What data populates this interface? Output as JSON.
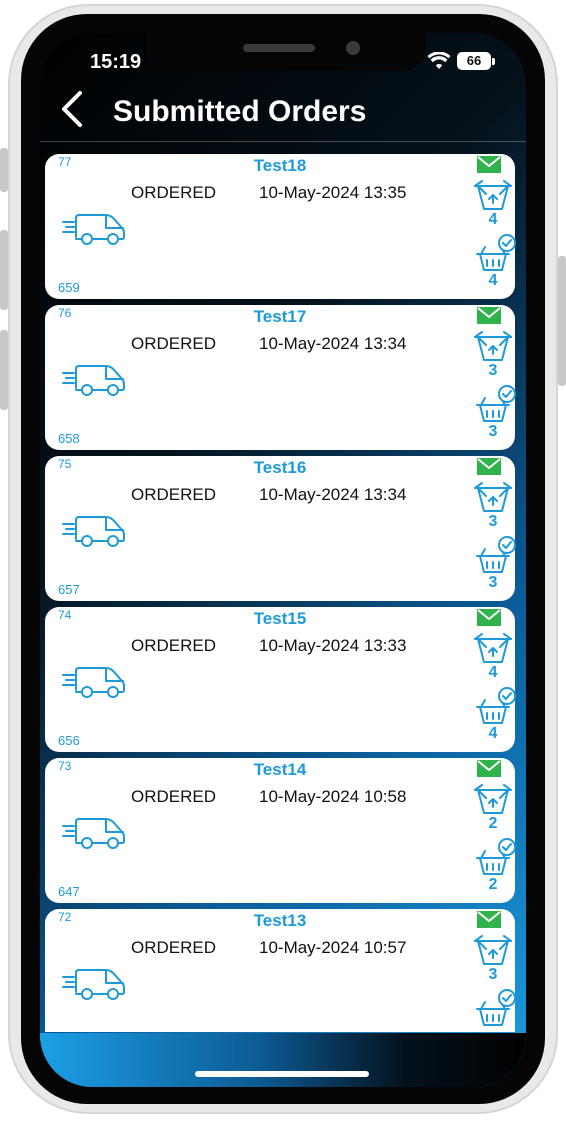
{
  "status_bar": {
    "time": "15:19",
    "battery": "66"
  },
  "header": {
    "title": "Submitted Orders"
  },
  "orders": [
    {
      "id": "77",
      "name": "Test18",
      "status": "ORDERED",
      "date": "10-May-2024 13:35",
      "ref": "659",
      "count_sent": "4",
      "count_confirmed": "4"
    },
    {
      "id": "76",
      "name": "Test17",
      "status": "ORDERED",
      "date": "10-May-2024 13:34",
      "ref": "658",
      "count_sent": "3",
      "count_confirmed": "3"
    },
    {
      "id": "75",
      "name": "Test16",
      "status": "ORDERED",
      "date": "10-May-2024 13:34",
      "ref": "657",
      "count_sent": "3",
      "count_confirmed": "3"
    },
    {
      "id": "74",
      "name": "Test15",
      "status": "ORDERED",
      "date": "10-May-2024 13:33",
      "ref": "656",
      "count_sent": "4",
      "count_confirmed": "4"
    },
    {
      "id": "73",
      "name": "Test14",
      "status": "ORDERED",
      "date": "10-May-2024 10:58",
      "ref": "647",
      "count_sent": "2",
      "count_confirmed": "2"
    },
    {
      "id": "72",
      "name": "Test13",
      "status": "ORDERED",
      "date": "10-May-2024 10:57",
      "ref": "",
      "count_sent": "3",
      "count_confirmed": ""
    }
  ],
  "icons": {
    "back": "chevron-left-icon",
    "van": "delivery-van-icon",
    "mail": "envelope-icon",
    "basket_up": "basket-upload-icon",
    "basket_check": "basket-confirmed-icon"
  },
  "colors": {
    "accent_blue": "#1e9ad8",
    "mail_green": "#2fb34a",
    "header_gradient_light": "#1b9ee3"
  }
}
